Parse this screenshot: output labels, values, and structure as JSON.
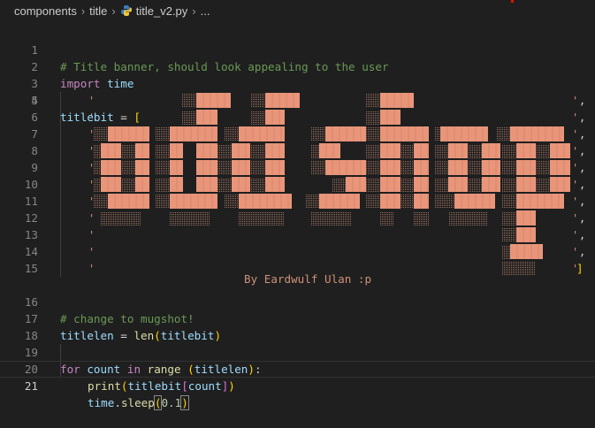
{
  "breadcrumb": {
    "items": [
      "components",
      "title",
      "title_v2.py",
      "..."
    ]
  },
  "icons": {
    "chevron": "chevron-right-icon",
    "python": "python-file-icon"
  },
  "colors": {
    "background": "#1f1f1f",
    "comment": "#6a9955",
    "keyword": "#569cd6",
    "control_keyword": "#c586c0",
    "variable": "#9cdcfe",
    "function": "#dcdcaa",
    "number": "#b5cea8",
    "string": "#ce9178",
    "art_block": "#e8957a"
  },
  "editor": {
    "active_line": 21,
    "line_numbers": [
      "1",
      "2",
      "3",
      "4",
      "5",
      "6",
      "7",
      "8",
      "9",
      "10",
      "11",
      "12",
      "13",
      "14",
      "15",
      "16",
      "17",
      "18",
      "19",
      "20",
      "21"
    ],
    "l1_comment": "# Title banner, should look appealing to the user",
    "l2_import": "import",
    "l2_module": "time",
    "l4_var": "titlebit",
    "l4_eq": " = ",
    "l4_bracket": "[",
    "l14_byline": "By Eardwulf Ulan :p",
    "l15_close": "]",
    "l16_comment": "# change to mugshot!",
    "l17_var": "titlelen",
    "l17_eq": " = ",
    "l17_fn": "len",
    "l17_arg": "titlebit",
    "l19_for": "for",
    "l19_var": "count",
    "l19_in": "in",
    "l19_fn": "range",
    "l19_arg": "titlelen",
    "l19_colon": ":",
    "l20_fn": "print",
    "l20_var": "titlebit",
    "l20_idx": "count",
    "l21_mod": "time",
    "l21_fn": "sleep",
    "l21_num": "0.1"
  }
}
